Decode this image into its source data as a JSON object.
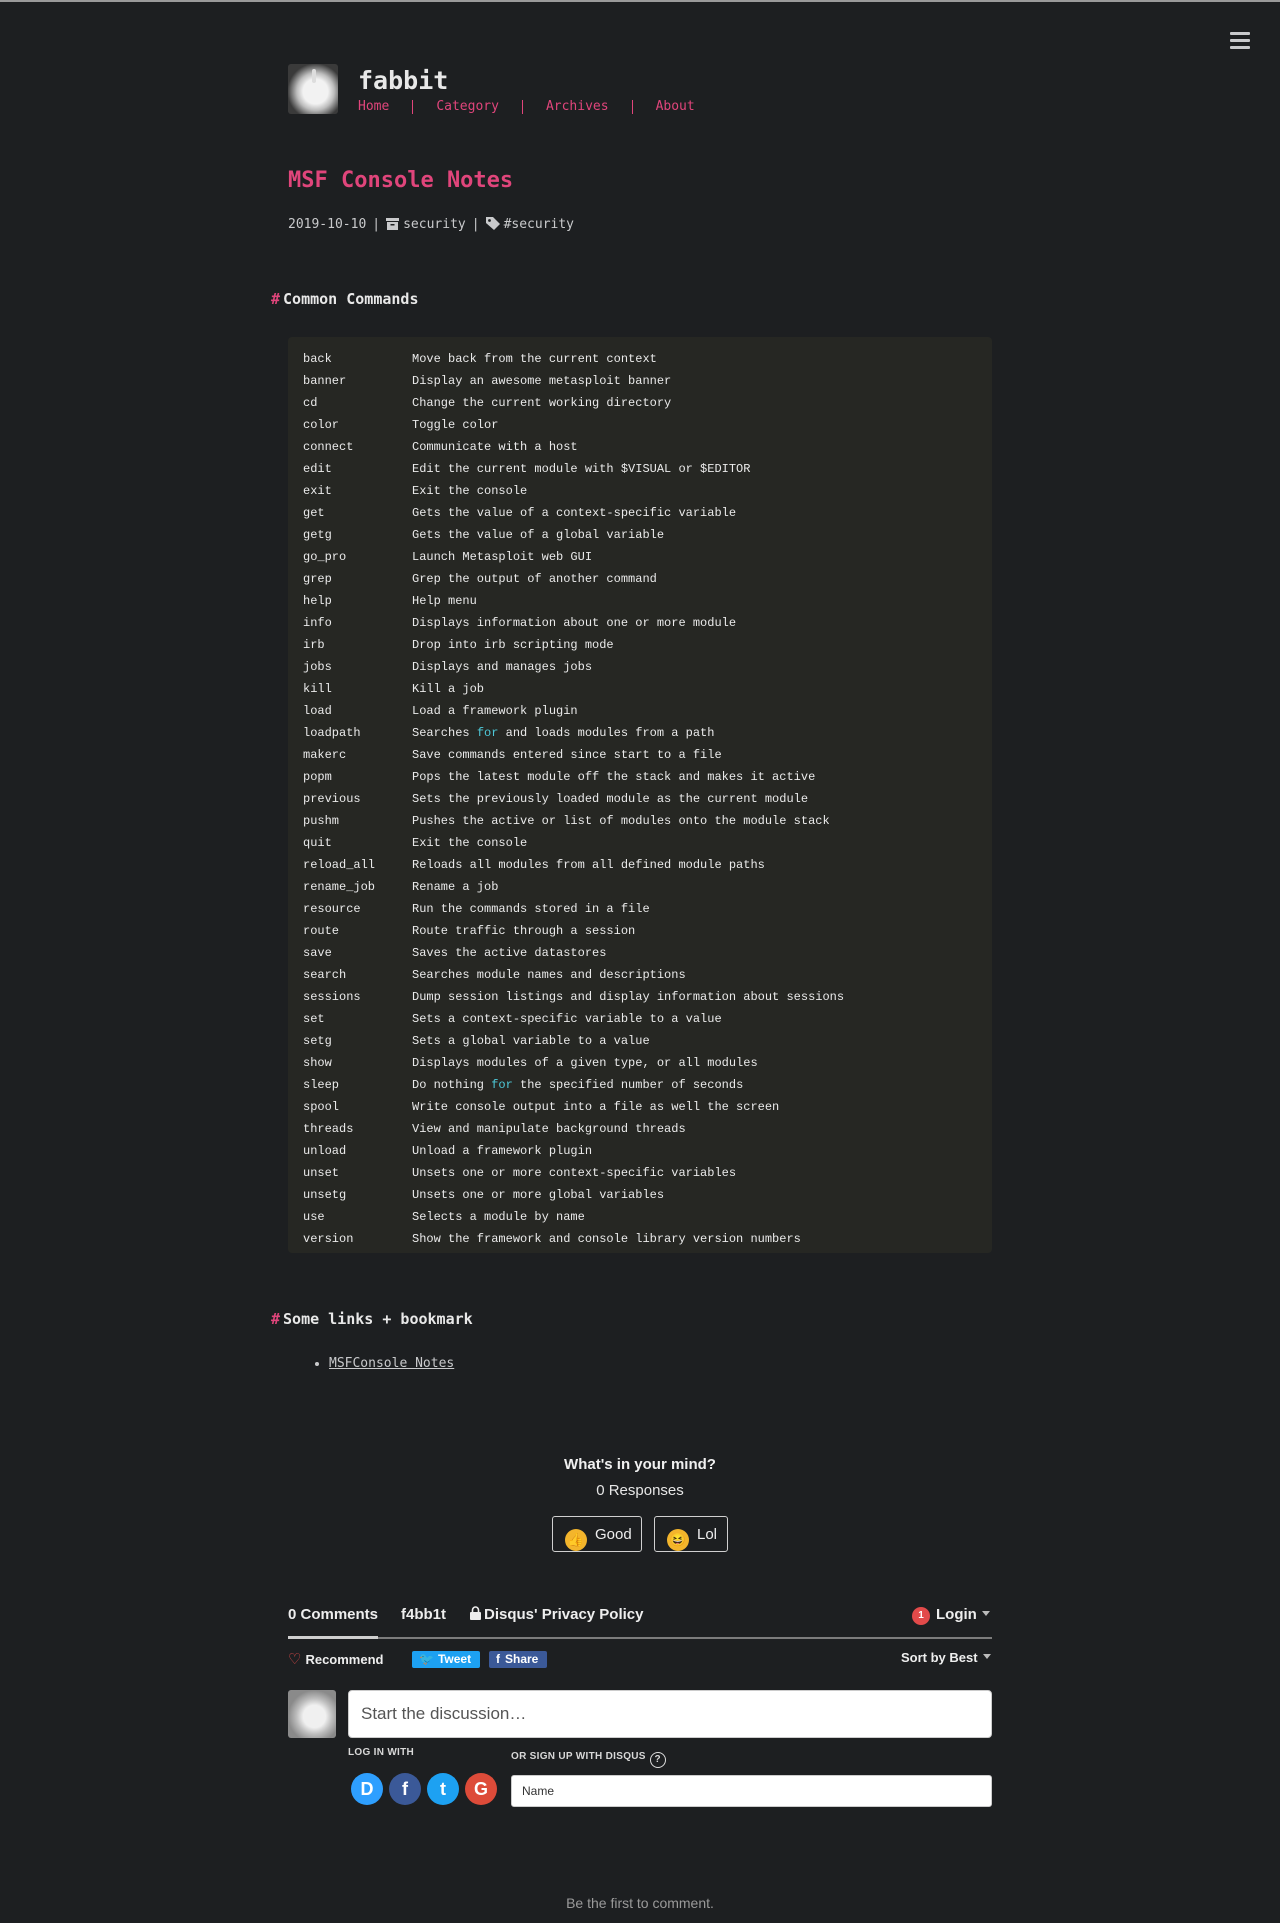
{
  "site": {
    "title": "fabbit",
    "nav": [
      "Home",
      "Category",
      "Archives",
      "About"
    ]
  },
  "post": {
    "title": "MSF Console Notes",
    "date": "2019-10-10",
    "category": "security",
    "tag": "#security"
  },
  "sections": {
    "commands_heading": "Common Commands",
    "links_heading": "Some links + bookmark",
    "link_label": "MSFConsole Notes"
  },
  "commands": [
    [
      "back",
      "Move back from the current context"
    ],
    [
      "banner",
      "Display an awesome metasploit banner"
    ],
    [
      "cd",
      "Change the current working directory"
    ],
    [
      "color",
      "Toggle color"
    ],
    [
      "connect",
      "Communicate with a host"
    ],
    [
      "edit",
      "Edit the current module with $VISUAL or $EDITOR"
    ],
    [
      "exit",
      "Exit the console"
    ],
    [
      "get",
      "Gets the value of a context-specific variable"
    ],
    [
      "getg",
      "Gets the value of a global variable"
    ],
    [
      "go_pro",
      "Launch Metasploit web GUI"
    ],
    [
      "grep",
      "Grep the output of another command"
    ],
    [
      "help",
      "Help menu"
    ],
    [
      "info",
      "Displays information about one or more module"
    ],
    [
      "irb",
      "Drop into irb scripting mode"
    ],
    [
      "jobs",
      "Displays and manages jobs"
    ],
    [
      "kill",
      "Kill a job"
    ],
    [
      "load",
      "Load a framework plugin"
    ],
    [
      "loadpath",
      "Searches for and loads modules from a path"
    ],
    [
      "makerc",
      "Save commands entered since start to a file"
    ],
    [
      "popm",
      "Pops the latest module off the stack and makes it active"
    ],
    [
      "previous",
      "Sets the previously loaded module as the current module"
    ],
    [
      "pushm",
      "Pushes the active or list of modules onto the module stack"
    ],
    [
      "quit",
      "Exit the console"
    ],
    [
      "reload_all",
      "Reloads all modules from all defined module paths"
    ],
    [
      "rename_job",
      "Rename a job"
    ],
    [
      "resource",
      "Run the commands stored in a file"
    ],
    [
      "route",
      "Route traffic through a session"
    ],
    [
      "save",
      "Saves the active datastores"
    ],
    [
      "search",
      "Searches module names and descriptions"
    ],
    [
      "sessions",
      "Dump session listings and display information about sessions"
    ],
    [
      "set",
      "Sets a context-specific variable to a value"
    ],
    [
      "setg",
      "Sets a global variable to a value"
    ],
    [
      "show",
      "Displays modules of a given type, or all modules"
    ],
    [
      "sleep",
      "Do nothing for the specified number of seconds"
    ],
    [
      "spool",
      "Write console output into a file as well the screen"
    ],
    [
      "threads",
      "View and manipulate background threads"
    ],
    [
      "unload",
      "Unload a framework plugin"
    ],
    [
      "unset",
      "Unsets one or more context-specific variables"
    ],
    [
      "unsetg",
      "Unsets one or more global variables"
    ],
    [
      "use",
      "Selects a module by name"
    ],
    [
      "version",
      "Show the framework and console library version numbers"
    ]
  ],
  "reactions": {
    "title": "What's in your mind?",
    "count": "0 Responses",
    "good": "Good",
    "lol": "Lol"
  },
  "disqus": {
    "comments_tab": "0 Comments",
    "site_tab": "f4bb1t",
    "privacy": "Disqus' Privacy Policy",
    "notif_count": "1",
    "login": "Login",
    "recommend": "Recommend",
    "tweet": "Tweet",
    "share": "Share",
    "sort": "Sort by Best",
    "placeholder": "Start the discussion…",
    "log_in_with": "LOG IN WITH",
    "or_sign_up": "OR SIGN UP WITH DISQUS",
    "name_placeholder": "Name",
    "empty": "Be the first to comment."
  },
  "colors": {
    "background": "#1d1f21",
    "accent": "#e0457b",
    "code_background": "#262723",
    "keyword": "#4ec9d8"
  }
}
